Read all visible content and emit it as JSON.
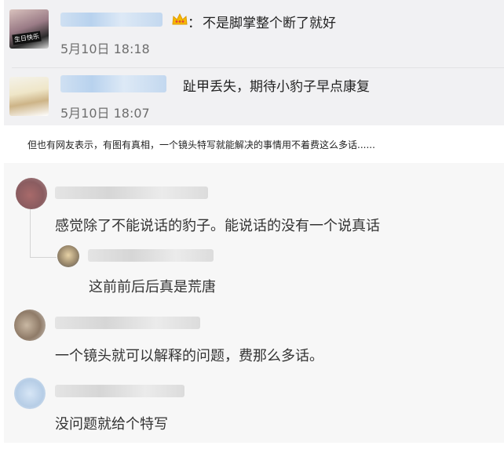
{
  "replies": [
    {
      "badge_icon": "crown-icon",
      "colon": "：",
      "text": "不是脚掌整个断了就好",
      "time": "5月10日 18:18",
      "avatar_text": "生日快乐"
    },
    {
      "text": "趾甲丢失，期待小豹子早点康复",
      "time": "5月10日 18:07"
    }
  ],
  "caption": "但也有网友表示，有图有真相，一个镜头特写就能解决的事情用不着费这么多话......",
  "comments": [
    {
      "text": "感觉除了不能说话的豹子。能说话的没有一个说真话"
    },
    {
      "text": "这前前后后真是荒唐",
      "is_reply": true
    },
    {
      "text": "一个镜头就可以解释的问题，费那么多话。"
    },
    {
      "text": "没问题就给个特写"
    }
  ],
  "colors": {
    "accent_crown": "#f5b800",
    "panel": "#f1f1f3"
  }
}
